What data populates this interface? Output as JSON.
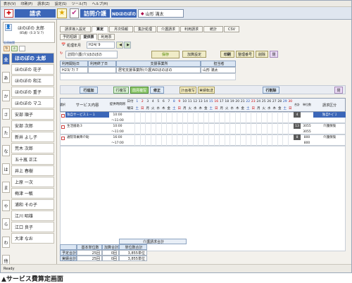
{
  "menu": [
    "表示(V)",
    "印刷(P)",
    "請求(Z)",
    "設定(S)",
    "ツール(T)",
    "ヘルプ(H)"
  ],
  "title": {
    "screen": "請求",
    "service": "訪問介護",
    "office": "NDほのぼの",
    "staff": "山形 滿太"
  },
  "header_client": {
    "name": "ほのぼの 太郎",
    "detail": "（85歳）(S 2/ 5/ 7)"
  },
  "sidebar_label": "医療機関",
  "kana": [
    "全",
    "あ",
    "か",
    "さ",
    "た",
    "な",
    "は",
    "ま",
    "や",
    "ら",
    "わ",
    "他"
  ],
  "clients": [
    "ほのぼの 太郎",
    "ほのぼの 花子",
    "ほのぼの 和江",
    "ほのぼの 重子",
    "ほのぼの マユ",
    "安部 順子",
    "安部 次郎",
    "新井 よし子",
    "荒木 次郎",
    "五十嵐 正江",
    "井上 春樹",
    "上原 一次",
    "梅津 一敏",
    "浦和 その子",
    "江川 昭雄",
    "江口 良子",
    "大津 なお"
  ],
  "tabs": [
    "請求導入設定",
    "算定",
    "月次情報",
    "集計処理",
    "介護請求",
    "利用請求",
    "統計",
    "CSV"
  ],
  "subtabs": [
    "予防短期",
    "提供票",
    "利用票"
  ],
  "month": {
    "label": "処理年月",
    "value": "H24/ 9"
  },
  "account": {
    "label": "訪問介護(介)ほのぼの",
    "button": "保存",
    "actions": [
      "加算設定",
      "印刷",
      "整理番号",
      "削除",
      "閉"
    ]
  },
  "plan_headers": [
    "利用開始日",
    "利用終了日",
    "支援事業所",
    "担当者"
  ],
  "plan_values": [
    "H23/ 7/ 7",
    "",
    "居宅支援事業所(介護)NDほのぼの",
    "山形 滿太"
  ],
  "actions2": [
    "行追加",
    "行複写",
    "前月複写",
    "修正",
    "計画複写",
    "実績転送",
    "行削除",
    "閉"
  ],
  "grid_headers": {
    "select": "選択",
    "service": "サービス内容",
    "time": "提供時間帯",
    "days_label": "日付",
    "weekday_label": "曜日",
    "count": "合計",
    "units": "単位数",
    "billing": "請求区分"
  },
  "days": [
    "1",
    "2",
    "3",
    "4",
    "5",
    "6",
    "7",
    "8",
    "9",
    "10",
    "11",
    "12",
    "13",
    "14",
    "15",
    "16",
    "17",
    "18",
    "19",
    "20",
    "21",
    "22",
    "23",
    "24",
    "25",
    "26",
    "27",
    "28",
    "29",
    "30"
  ],
  "weekdays": [
    "土",
    "日",
    "月",
    "火",
    "水",
    "木",
    "金",
    "土",
    "日",
    "月",
    "火",
    "水",
    "木",
    "金",
    "土",
    "日",
    "月",
    "火",
    "水",
    "木",
    "金",
    "土",
    "日",
    "月",
    "火",
    "水",
    "木",
    "金",
    "土",
    "日"
  ],
  "rows": [
    {
      "service": "独自サービス１－１",
      "time1": "10:00",
      "time2": "～11:00",
      "count": "4",
      "units": "",
      "billing": "独自ｻｰﾋﾞｽ"
    },
    {
      "service": "生活援助３",
      "time1": "10:00",
      "time2": "～11:00",
      "count": "13",
      "units": "3055",
      "billing": "介護保険"
    },
    {
      "service": "通院等乗降介助",
      "time1": "16:00",
      "time2": "～17:00",
      "count": "8",
      "units": "800",
      "billing": "介護保険"
    }
  ],
  "row2_extra": {
    "units": "3055"
  },
  "row3_extra": {
    "units": "800"
  },
  "summary": {
    "title": "介護請求合計",
    "headers": [
      "基本単位数",
      "加算合計",
      "単位数合計"
    ],
    "rows": [
      [
        "予定合計",
        "25回",
        "0回",
        "3,855単位"
      ],
      [
        "実績合計",
        "25回",
        "0回",
        "3,855単位"
      ]
    ]
  },
  "status": "Ready",
  "caption": "▲サービス費算定画面",
  "colors": {
    "accent": "#3b66b8",
    "header": "#dbe6f3",
    "button": "#f0ecc8"
  }
}
